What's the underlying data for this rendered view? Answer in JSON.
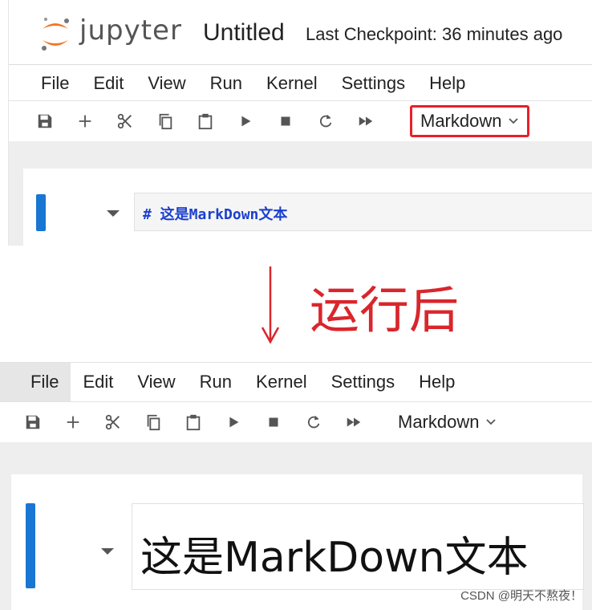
{
  "top": {
    "logo_text": "jupyter",
    "notebook_title": "Untitled",
    "checkpoint_text": "Last Checkpoint: 36 minutes ago",
    "menu": [
      "File",
      "Edit",
      "View",
      "Run",
      "Kernel",
      "Settings",
      "Help"
    ],
    "toolbar_icons": [
      "save-icon",
      "add-icon",
      "cut-icon",
      "copy-icon",
      "paste-icon",
      "run-icon",
      "stop-icon",
      "restart-icon",
      "fast-forward-icon"
    ],
    "cell_type": "Markdown",
    "cell_source": "# 这是MarkDown文本",
    "highlight_color": "#e8202a"
  },
  "annotation": {
    "label": "运行后",
    "color": "#d9262c"
  },
  "bottom": {
    "menu": [
      "File",
      "Edit",
      "View",
      "Run",
      "Kernel",
      "Settings",
      "Help"
    ],
    "cell_type": "Markdown",
    "rendered_text": "这是MarkDown文本"
  },
  "watermark": "CSDN @明天不熬夜！",
  "colors": {
    "cell_marker": "#1976d2",
    "markdown_source": "#1a3fd0"
  }
}
